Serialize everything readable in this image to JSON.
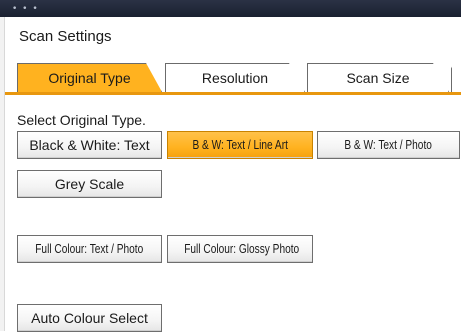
{
  "window": {
    "title": "Scan Settings"
  },
  "tabs": [
    {
      "label": "Original Type",
      "active": true
    },
    {
      "label": "Resolution",
      "active": false
    },
    {
      "label": "Scan Size",
      "active": false
    }
  ],
  "section": {
    "prompt": "Select Original Type."
  },
  "options": {
    "bw_text": "Black & White: Text",
    "bw_line_art": "B & W: Text / Line Art",
    "bw_photo": "B & W: Text / Photo",
    "grey_scale": "Grey Scale",
    "full_colour_text_photo": "Full Colour: Text / Photo",
    "full_colour_glossy": "Full Colour: Glossy Photo",
    "auto_colour": "Auto Colour Select"
  },
  "selected": "bw_line_art",
  "colors": {
    "accent": "#ffb21f",
    "tab_underline": "#e8970f"
  }
}
